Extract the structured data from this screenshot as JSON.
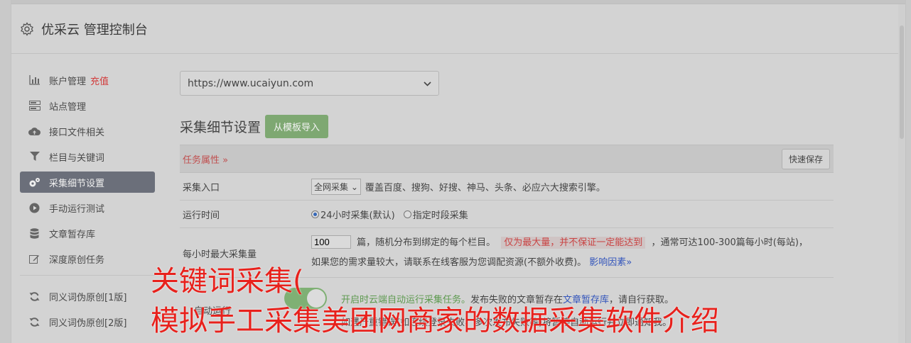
{
  "header": {
    "title": "优采云 管理控制台",
    "icon": "gear-icon"
  },
  "sidebar": {
    "items": [
      {
        "label": "账户管理",
        "badge": "充值",
        "icon": "bar-chart-icon"
      },
      {
        "label": "站点管理",
        "icon": "server-icon"
      },
      {
        "label": "接口文件相关",
        "icon": "cloud-upload-icon"
      },
      {
        "label": "栏目与关键词",
        "icon": "filter-icon"
      },
      {
        "label": "采集细节设置",
        "icon": "gears-icon",
        "active": true
      },
      {
        "label": "手动运行测试",
        "icon": "play-icon"
      },
      {
        "label": "文章暂存库",
        "icon": "database-icon"
      },
      {
        "label": "深度原创任务",
        "icon": "edit-icon"
      }
    ],
    "items2": [
      {
        "label": "同义词伪原创[1版]",
        "icon": "refresh-icon"
      },
      {
        "label": "同义词伪原创[2版]",
        "icon": "refresh-icon"
      }
    ]
  },
  "main": {
    "site_select": "https://www.ucaiyun.com",
    "section_title": "采集细节设置",
    "import_button": "从模板导入",
    "panel": {
      "task_attr": "任务属性 »",
      "quick_save": "快速保存",
      "rows": {
        "entry": {
          "label": "采集入口",
          "select": "全网采集",
          "desc": "覆盖百度、搜狗、好搜、神马、头条、必应六大搜索引擎。"
        },
        "time": {
          "label": "运行时间",
          "opt1": "24小时采集(默认)",
          "opt2": "指定时段采集"
        },
        "max": {
          "label": "每小时最大采集量",
          "value": "100",
          "text1": "篇，随机分布到绑定的每个栏目。",
          "warn": "仅为最大量，并不保证一定能达到",
          "text2": "，通常可达100-300篇每小时(每站)，",
          "text3": "如果您的需求量较大，请联系在线客服为您调配资源(不额外收费)。",
          "link": "影响因素»"
        },
        "auto": {
          "label": "自动运行",
          "green": "开启时云端自动运行采集任务。",
          "text1": "发布失败的文章暂存在",
          "link": "文章暂存库",
          "text2": "，请自行获取。",
          "text3": "如遇严重错误(如连续登录失败、多次发布失败等)将暂停自动运行并立即通知我。"
        }
      }
    }
  },
  "overlay": {
    "line1": "关键词采集(",
    "line2": "模拟手工采集美团网商家的数据采集软件介绍"
  }
}
